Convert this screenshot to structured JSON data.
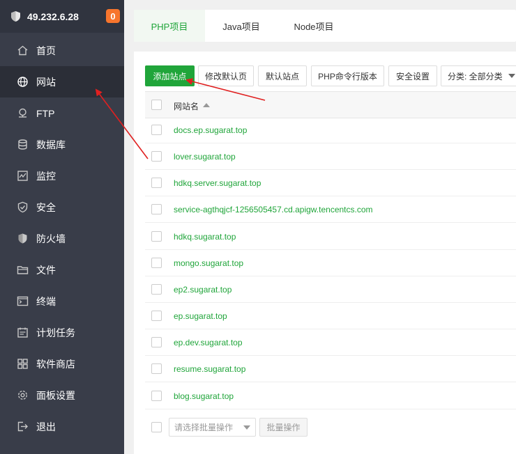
{
  "sidebar": {
    "ip": "49.232.6.28",
    "badge": "0",
    "items": [
      {
        "label": "首页",
        "icon": "home-icon"
      },
      {
        "label": "网站",
        "icon": "globe-icon"
      },
      {
        "label": "FTP",
        "icon": "ftp-icon"
      },
      {
        "label": "数据库",
        "icon": "database-icon"
      },
      {
        "label": "监控",
        "icon": "monitor-icon"
      },
      {
        "label": "安全",
        "icon": "shield-check-icon"
      },
      {
        "label": "防火墙",
        "icon": "firewall-icon"
      },
      {
        "label": "文件",
        "icon": "folder-icon"
      },
      {
        "label": "终端",
        "icon": "terminal-icon"
      },
      {
        "label": "计划任务",
        "icon": "schedule-icon"
      },
      {
        "label": "软件商店",
        "icon": "app-store-icon"
      },
      {
        "label": "面板设置",
        "icon": "settings-icon"
      },
      {
        "label": "退出",
        "icon": "logout-icon"
      }
    ],
    "active": "网站"
  },
  "tabs": [
    {
      "label": "PHP项目"
    },
    {
      "label": "Java项目"
    },
    {
      "label": "Node项目"
    }
  ],
  "toolbar": {
    "add_site": "添加站点",
    "edit_default_page": "修改默认页",
    "default_site": "默认站点",
    "php_cli_version": "PHP命令行版本",
    "security_settings": "安全设置",
    "category": "分类: 全部分类"
  },
  "table": {
    "header": "网站名",
    "rows": [
      "docs.ep.sugarat.top",
      "lover.sugarat.top",
      "hdkq.server.sugarat.top",
      "service-agthqjcf-1256505457.cd.apigw.tencentcs.com",
      "hdkq.sugarat.top",
      "mongo.sugarat.top",
      "ep2.sugarat.top",
      "ep.sugarat.top",
      "ep.dev.sugarat.top",
      "resume.sugarat.top",
      "blog.sugarat.top"
    ]
  },
  "batch": {
    "placeholder": "请选择批量操作",
    "button": "批量操作"
  },
  "colors": {
    "sidebar_bg": "#393d49",
    "accent_green": "#20a53a",
    "badge_orange": "#f7752d",
    "annotation_red": "#e02020"
  }
}
